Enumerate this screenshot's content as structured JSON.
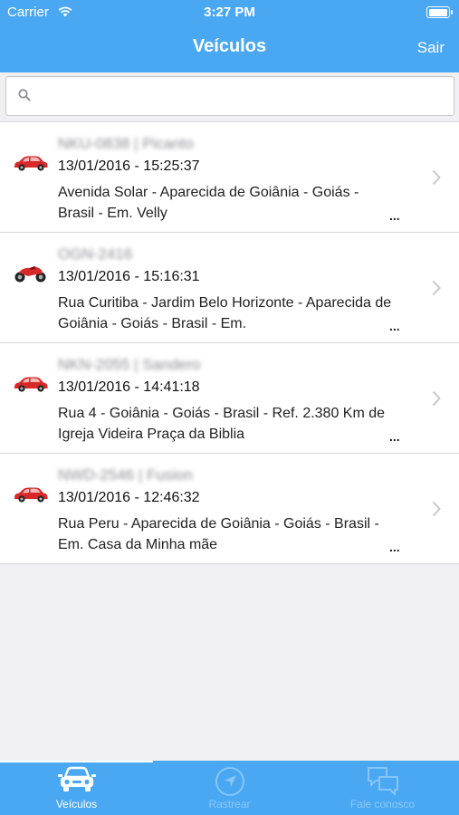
{
  "status_bar": {
    "carrier": "Carrier",
    "time": "3:27 PM",
    "battery_level": 1.0
  },
  "nav": {
    "title": "Veículos",
    "right_button": "Sair"
  },
  "search": {
    "placeholder": "",
    "value": ""
  },
  "vehicles": [
    {
      "icon": "car-icon",
      "plate": "NKU-0838 | Picanto",
      "datetime": "13/01/2016 - 15:25:37",
      "address": "Avenida Solar - Aparecida de Goiânia - Goiás - Brasil - Em. Velly",
      "more": "..."
    },
    {
      "icon": "motorcycle-icon",
      "plate": "OGN-2416",
      "datetime": "13/01/2016 - 15:16:31",
      "address": "Rua Curitiba - Jardim Belo Horizonte - Aparecida de Goiânia - Goiás - Brasil - Em.",
      "more": "..."
    },
    {
      "icon": "car-icon",
      "plate": "NKN-2055 | Sandero",
      "datetime": "13/01/2016 - 14:41:18",
      "address": "Rua 4 - Goiânia - Goiás - Brasil - Ref. 2.380 Km de Igreja Videira Praça da Biblia",
      "more": "..."
    },
    {
      "icon": "car-icon",
      "plate": "NWD-2546 | Fusion",
      "datetime": "13/01/2016 - 12:46:32",
      "address": "Rua Peru - Aparecida de Goiânia - Goiás - Brasil - Em. Casa da Minha mãe",
      "more": "..."
    }
  ],
  "tabs": [
    {
      "label": "Veículos",
      "icon": "car-front-icon",
      "active": true
    },
    {
      "label": "Rastrear",
      "icon": "navigation-arrow-icon",
      "active": false
    },
    {
      "label": "Fale conosco",
      "icon": "chat-bubbles-icon",
      "active": false
    }
  ],
  "colors": {
    "accent": "#4aa8f2",
    "vehicle_red": "#d7282a",
    "background": "#efeff4"
  }
}
